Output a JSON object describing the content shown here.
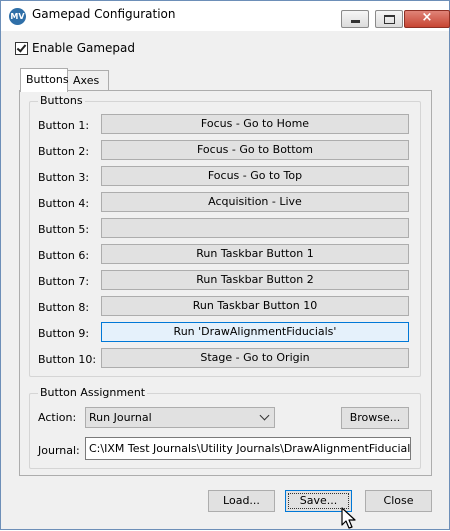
{
  "window": {
    "title": "Gamepad Configuration",
    "icon_text": "MV"
  },
  "enable": {
    "label": "Enable Gamepad",
    "checked": true
  },
  "tabs": [
    {
      "label": "Buttons",
      "active": true
    },
    {
      "label": "Axes",
      "active": false
    }
  ],
  "buttons_group": {
    "title": "Buttons",
    "rows": [
      {
        "label": "Button 1:",
        "action": "Focus - Go to Home"
      },
      {
        "label": "Button 2:",
        "action": "Focus - Go to Bottom"
      },
      {
        "label": "Button 3:",
        "action": "Focus - Go to Top"
      },
      {
        "label": "Button 4:",
        "action": "Acquisition - Live"
      },
      {
        "label": "Button 5:",
        "action": ""
      },
      {
        "label": "Button 6:",
        "action": "Run Taskbar Button 1"
      },
      {
        "label": "Button 7:",
        "action": "Run Taskbar Button 2"
      },
      {
        "label": "Button 8:",
        "action": "Run Taskbar Button 10"
      },
      {
        "label": "Button 9:",
        "action": "Run 'DrawAlignmentFiducials'"
      },
      {
        "label": "Button 10:",
        "action": "Stage - Go to Origin"
      }
    ]
  },
  "assignment": {
    "title": "Button Assignment",
    "action_label": "Action:",
    "action_value": "Run Journal",
    "browse_label": "Browse...",
    "journal_label": "Journal:",
    "journal_value": "C:\\IXM Test Journals\\Utility Journals\\DrawAlignmentFiducials.JNL"
  },
  "footer": {
    "load_label": "Load...",
    "save_label": "Save...",
    "close_label": "Close"
  },
  "colors": {
    "selected_border": "#0078d7",
    "selected_fill": "#e5f1fb",
    "close_button": "#c74533"
  }
}
